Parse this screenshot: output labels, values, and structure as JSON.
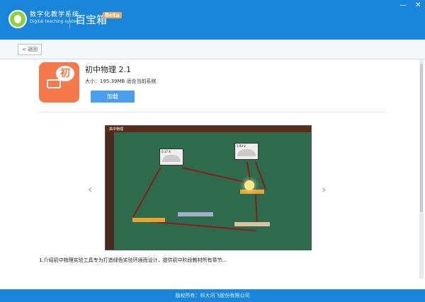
{
  "header": {
    "brand_cn": "数字化教学系统",
    "brand_en": "Digital teaching system",
    "app_name": "百宝箱",
    "beta": "Beta",
    "min": "—",
    "close": "✕"
  },
  "nav": {
    "back": "< 返回"
  },
  "app": {
    "title": "初中物理 2.1",
    "size": "大小：195.39MB  适合当前系统",
    "load": "加载",
    "icon_text": "初"
  },
  "preview": {
    "app_title": "高中物理",
    "meter1": "0.17 A",
    "meter2": "1.93 V",
    "left_arrow": "‹",
    "right_arrow": "›"
  },
  "description": "1.介绍初中物理实验工具专为打造绿色实验环境而设计，提供初中阶段教材所有章节...",
  "footer": "版权所有：科大讯飞股份有限公司",
  "colors": {
    "brand": "#1a86db",
    "button": "#4a9ef0",
    "icon_bg": "#f5794a"
  }
}
